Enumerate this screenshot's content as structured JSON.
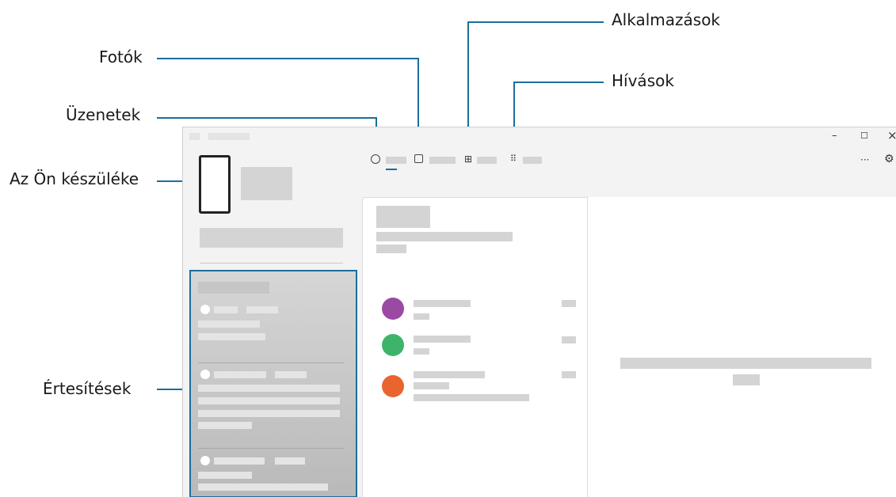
{
  "callouts": {
    "apps": "Alkalmazások",
    "photos": "Fotók",
    "calls": "Hívások",
    "messages": "Üzenetek",
    "device": "Az Ön készüléke",
    "notifications": "Értesítések"
  },
  "window": {
    "minimize": "–",
    "maximize": "☐",
    "close": "×",
    "more": "···",
    "settings": "⚙"
  },
  "tabs": {
    "messages_icon": "message-icon",
    "photos_icon": "photo-icon",
    "apps_icon": "apps-grid-icon",
    "calls_icon": "dialpad-icon"
  },
  "colors": {
    "callout_line": "#1b6e9c",
    "avatar_1": "#9b4aa3",
    "avatar_2": "#3db46a",
    "avatar_3": "#e8652f"
  }
}
